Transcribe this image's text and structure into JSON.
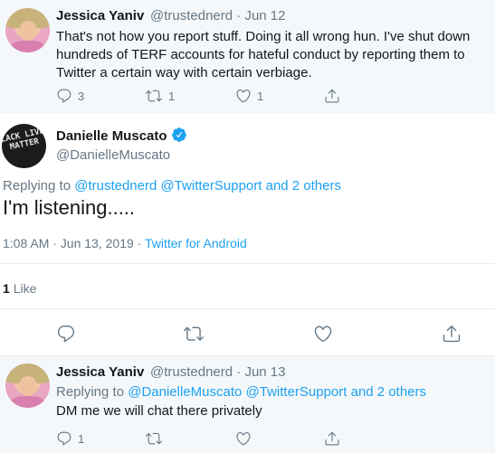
{
  "tweet1": {
    "name": "Jessica Yaniv",
    "handle": "@trustednerd",
    "separator": "·",
    "date": "Jun 12",
    "text": "That's not how you report stuff. Doing it all wrong hun. I've shut down hundreds of TERF accounts for hateful conduct by reporting them to Twitter a certain way with certain verbiage.",
    "reply_count": "3",
    "retweet_count": "1",
    "like_count": "1"
  },
  "main_tweet": {
    "name": "Danielle Muscato",
    "handle": "@DanielleMuscato",
    "avatar_text": "BLACK LIVES MATTER",
    "replying_prefix": "Replying to",
    "replying_to": "@trustednerd @TwitterSupport and 2 others",
    "text": "I'm listening.....",
    "timestamp": "1:08 AM · Jun 13, 2019",
    "separator": "·",
    "source": "Twitter for Android",
    "likes_count": "1",
    "likes_label": "Like"
  },
  "tweet3": {
    "name": "Jessica Yaniv",
    "handle": "@trustednerd",
    "separator": "·",
    "date": "Jun 13",
    "replying_prefix": "Replying to",
    "replying_to": "@DanielleMuscato @TwitterSupport and 2 others",
    "text": "DM me we will chat there privately",
    "reply_count": "1"
  },
  "colors": {
    "accent": "#1da1f2",
    "muted": "#657786",
    "divider": "#e6ecf0",
    "reply_bg": "#f5f8fa"
  },
  "icons": [
    "reply-icon",
    "retweet-icon",
    "like-icon",
    "share-icon",
    "verified-badge-icon"
  ]
}
